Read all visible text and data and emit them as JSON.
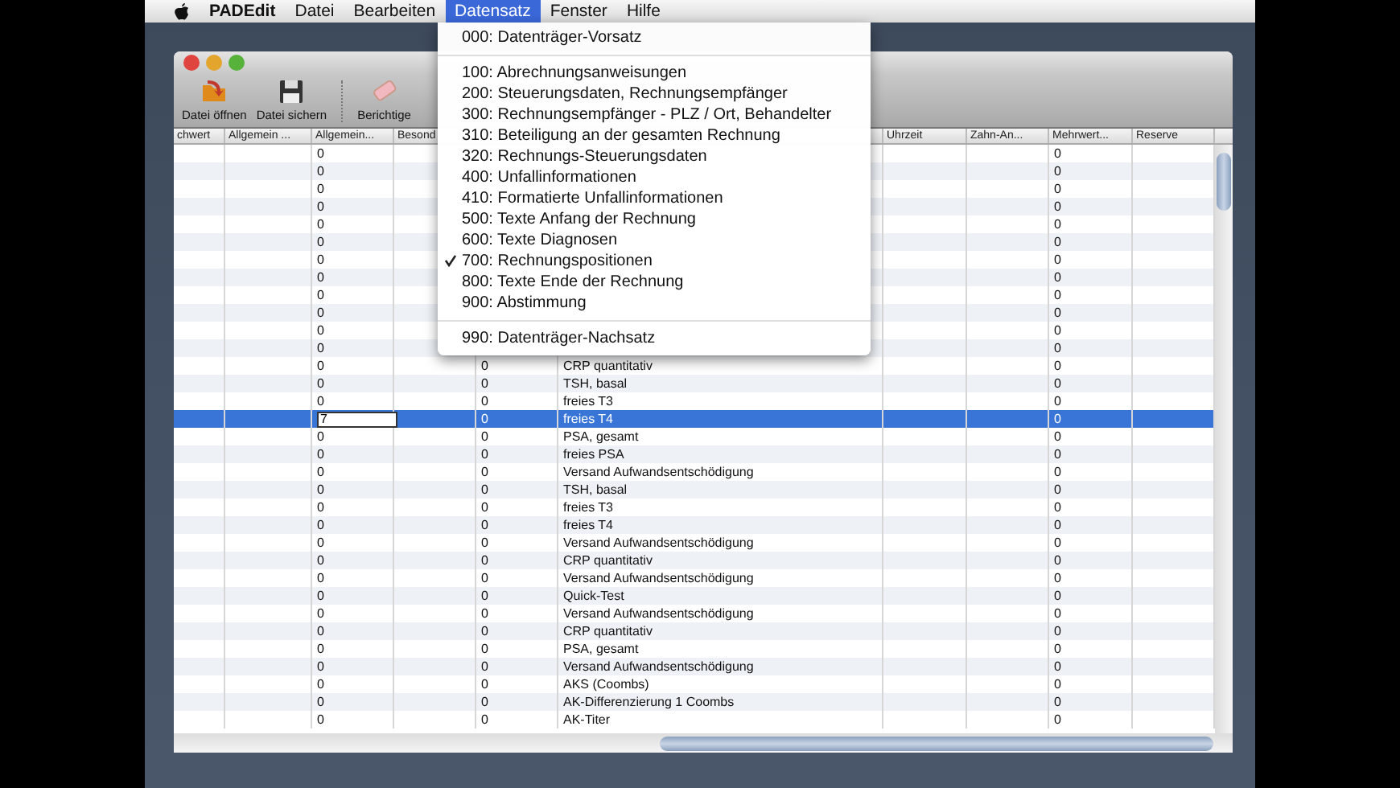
{
  "menu_bar": {
    "app_name": "PADEdit",
    "menus": [
      {
        "label": "Datei",
        "selected": false
      },
      {
        "label": "Bearbeiten",
        "selected": false
      },
      {
        "label": "Datensatz",
        "selected": true
      },
      {
        "label": "Fenster",
        "selected": false
      },
      {
        "label": "Hilfe",
        "selected": false
      }
    ]
  },
  "open_menu": {
    "items": [
      {
        "kind": "item",
        "label": "000: Datenträger-Vorsatz",
        "checked": false
      },
      {
        "kind": "separator"
      },
      {
        "kind": "item",
        "label": "100: Abrechnungsanweisungen",
        "checked": false
      },
      {
        "kind": "item",
        "label": "200: Steuerungsdaten, Rechnungsempfänger",
        "checked": false
      },
      {
        "kind": "item",
        "label": "300: Rechnungsempfänger - PLZ / Ort, Behandelter",
        "checked": false
      },
      {
        "kind": "item",
        "label": "310: Beteiligung an der gesamten Rechnung",
        "checked": false
      },
      {
        "kind": "item",
        "label": "320: Rechnungs-Steuerungsdaten",
        "checked": false
      },
      {
        "kind": "item",
        "label": "400: Unfallinformationen",
        "checked": false
      },
      {
        "kind": "item",
        "label": "410: Formatierte Unfallinformationen",
        "checked": false
      },
      {
        "kind": "item",
        "label": "500: Texte Anfang der Rechnung",
        "checked": false
      },
      {
        "kind": "item",
        "label": "600: Texte Diagnosen",
        "checked": false
      },
      {
        "kind": "item",
        "label": "700: Rechnungspositionen",
        "checked": true
      },
      {
        "kind": "item",
        "label": "800: Texte Ende der Rechnung",
        "checked": false
      },
      {
        "kind": "item",
        "label": "900: Abstimmung",
        "checked": false
      },
      {
        "kind": "separator"
      },
      {
        "kind": "item",
        "label": "990: Datenträger-Nachsatz",
        "checked": false
      }
    ]
  },
  "toolbar": [
    {
      "kind": "open",
      "label": "Datei öffnen"
    },
    {
      "kind": "save",
      "label": "Datei sichern"
    },
    {
      "kind": "correct",
      "label": "Berichtige"
    }
  ],
  "table": {
    "columns": [
      {
        "label": "chwert"
      },
      {
        "label": "Allgemein ..."
      },
      {
        "label": "Allgemein..."
      },
      {
        "label": "Besond"
      },
      {},
      {},
      {
        "label": "Uhrzeit"
      },
      {
        "label": "Zahn-An..."
      },
      {
        "label": "Mehrwert..."
      },
      {
        "label": "Reserve"
      }
    ],
    "rows": [
      {
        "selected": false,
        "cells": [
          null,
          null,
          "0",
          null,
          null,
          null,
          null,
          null,
          "0",
          null
        ]
      },
      {
        "selected": false,
        "cells": [
          null,
          null,
          "0",
          null,
          null,
          null,
          null,
          null,
          "0",
          null
        ]
      },
      {
        "selected": false,
        "cells": [
          null,
          null,
          "0",
          null,
          null,
          null,
          null,
          null,
          "0",
          null
        ]
      },
      {
        "selected": false,
        "cells": [
          null,
          null,
          "0",
          null,
          null,
          null,
          null,
          null,
          "0",
          null
        ]
      },
      {
        "selected": false,
        "cells": [
          null,
          null,
          "0",
          null,
          null,
          null,
          null,
          null,
          "0",
          null
        ]
      },
      {
        "selected": false,
        "cells": [
          null,
          null,
          "0",
          null,
          null,
          null,
          null,
          null,
          "0",
          null
        ]
      },
      {
        "selected": false,
        "cells": [
          null,
          null,
          "0",
          null,
          null,
          null,
          null,
          null,
          "0",
          null
        ]
      },
      {
        "selected": false,
        "cells": [
          null,
          null,
          "0",
          null,
          null,
          null,
          null,
          null,
          "0",
          null
        ]
      },
      {
        "selected": false,
        "cells": [
          null,
          null,
          "0",
          null,
          null,
          null,
          null,
          null,
          "0",
          null
        ]
      },
      {
        "selected": false,
        "cells": [
          null,
          null,
          "0",
          null,
          null,
          null,
          null,
          null,
          "0",
          null
        ]
      },
      {
        "selected": false,
        "cells": [
          null,
          null,
          "0",
          null,
          null,
          null,
          null,
          null,
          "0",
          null
        ]
      },
      {
        "selected": false,
        "cells": [
          null,
          null,
          "0",
          null,
          null,
          null,
          null,
          null,
          "0",
          null
        ]
      },
      {
        "selected": false,
        "cells": [
          null,
          null,
          "0",
          null,
          "0",
          "CRP quantitativ",
          null,
          null,
          "0",
          null
        ]
      },
      {
        "selected": false,
        "cells": [
          null,
          null,
          "0",
          null,
          "0",
          "TSH, basal",
          null,
          null,
          "0",
          null
        ]
      },
      {
        "selected": false,
        "cells": [
          null,
          null,
          "0",
          null,
          "0",
          "freies T3",
          null,
          null,
          "0",
          null
        ]
      },
      {
        "selected": true,
        "edit_value": "7",
        "cells": [
          null,
          null,
          null,
          null,
          "0",
          "freies T4",
          null,
          null,
          "0",
          null
        ]
      },
      {
        "selected": false,
        "cells": [
          null,
          null,
          "0",
          null,
          "0",
          "PSA, gesamt",
          null,
          null,
          "0",
          null
        ]
      },
      {
        "selected": false,
        "cells": [
          null,
          null,
          "0",
          null,
          "0",
          "freies PSA",
          null,
          null,
          "0",
          null
        ]
      },
      {
        "selected": false,
        "cells": [
          null,
          null,
          "0",
          null,
          "0",
          "Versand Aufwandsentschödigung",
          null,
          null,
          "0",
          null
        ]
      },
      {
        "selected": false,
        "cells": [
          null,
          null,
          "0",
          null,
          "0",
          "TSH, basal",
          null,
          null,
          "0",
          null
        ]
      },
      {
        "selected": false,
        "cells": [
          null,
          null,
          "0",
          null,
          "0",
          "freies T3",
          null,
          null,
          "0",
          null
        ]
      },
      {
        "selected": false,
        "cells": [
          null,
          null,
          "0",
          null,
          "0",
          "freies T4",
          null,
          null,
          "0",
          null
        ]
      },
      {
        "selected": false,
        "cells": [
          null,
          null,
          "0",
          null,
          "0",
          "Versand Aufwandsentschödigung",
          null,
          null,
          "0",
          null
        ]
      },
      {
        "selected": false,
        "cells": [
          null,
          null,
          "0",
          null,
          "0",
          "CRP quantitativ",
          null,
          null,
          "0",
          null
        ]
      },
      {
        "selected": false,
        "cells": [
          null,
          null,
          "0",
          null,
          "0",
          "Versand Aufwandsentschödigung",
          null,
          null,
          "0",
          null
        ]
      },
      {
        "selected": false,
        "cells": [
          null,
          null,
          "0",
          null,
          "0",
          "Quick-Test",
          null,
          null,
          "0",
          null
        ]
      },
      {
        "selected": false,
        "cells": [
          null,
          null,
          "0",
          null,
          "0",
          "Versand Aufwandsentschödigung",
          null,
          null,
          "0",
          null
        ]
      },
      {
        "selected": false,
        "cells": [
          null,
          null,
          "0",
          null,
          "0",
          "CRP quantitativ",
          null,
          null,
          "0",
          null
        ]
      },
      {
        "selected": false,
        "cells": [
          null,
          null,
          "0",
          null,
          "0",
          "PSA, gesamt",
          null,
          null,
          "0",
          null
        ]
      },
      {
        "selected": false,
        "cells": [
          null,
          null,
          "0",
          null,
          "0",
          "Versand Aufwandsentschödigung",
          null,
          null,
          "0",
          null
        ]
      },
      {
        "selected": false,
        "cells": [
          null,
          null,
          "0",
          null,
          "0",
          "AKS (Coombs)",
          null,
          null,
          "0",
          null
        ]
      },
      {
        "selected": false,
        "cells": [
          null,
          null,
          "0",
          null,
          "0",
          "AK-Differenzierung 1 Coombs",
          null,
          null,
          "0",
          null
        ]
      },
      {
        "selected": false,
        "cells": [
          null,
          null,
          "0",
          null,
          "0",
          "AK-Titer",
          null,
          null,
          "0",
          null
        ]
      }
    ]
  }
}
